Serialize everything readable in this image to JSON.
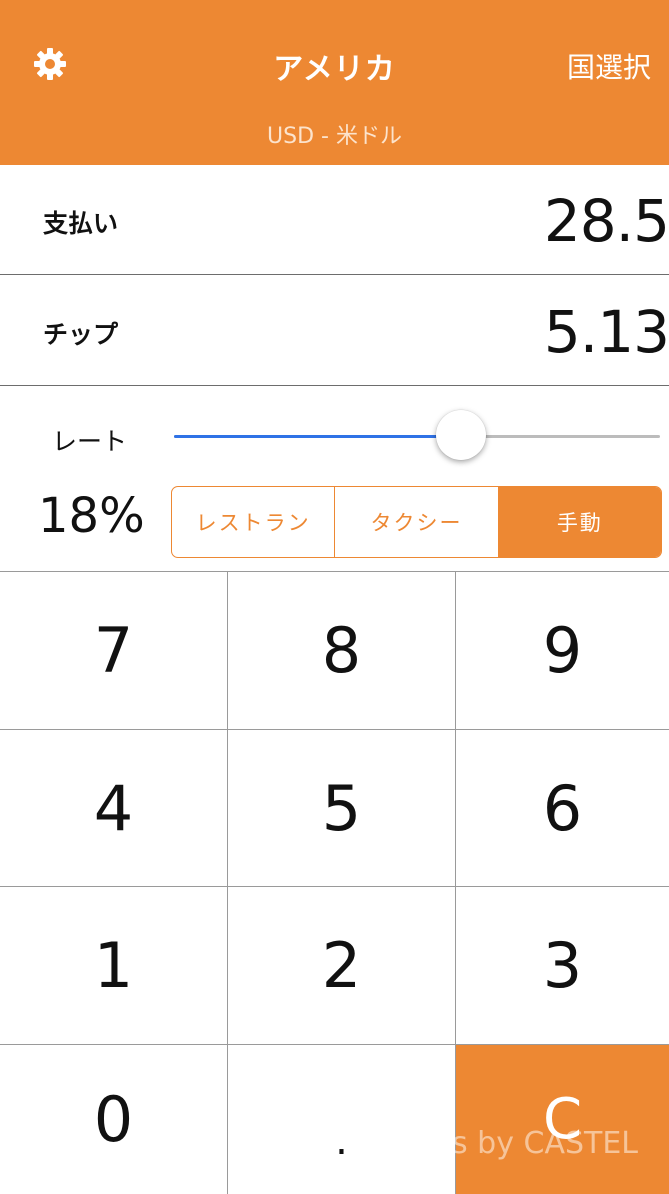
{
  "header": {
    "title": "アメリカ",
    "currency": "USD - 米ドル",
    "country_select_label": "国選択",
    "settings_icon": "gear-icon",
    "background_color": "#ED8833"
  },
  "payment": {
    "label": "支払い",
    "value": "28.5"
  },
  "tip": {
    "label": "チップ",
    "value": "5.13"
  },
  "rate": {
    "label": "レート",
    "value_text": "18%",
    "slider_fraction": 0.59,
    "slider_fill_color": "#2F72E6"
  },
  "tip_modes": {
    "options": [
      "レストラン",
      "タクシー",
      "手動"
    ],
    "selected": "手動"
  },
  "keypad": {
    "keys": [
      "7",
      "8",
      "9",
      "4",
      "5",
      "6",
      "1",
      "2",
      "3",
      "0",
      ".",
      "C"
    ],
    "clear_color": "#ED8833"
  },
  "watermark": "s by CASTEL"
}
